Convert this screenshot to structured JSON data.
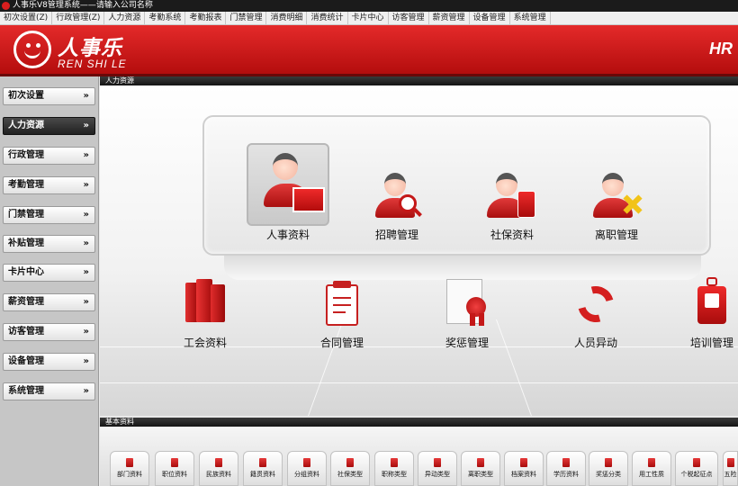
{
  "title": "人事乐V8管理系统——请输入公司名称",
  "menu": [
    "初次设置(Z)",
    "行政管理(Z)",
    "人力资源",
    "考勤系统",
    "考勤报表",
    "门禁管理",
    "消费明细",
    "消费统计",
    "卡片中心",
    "访客管理",
    "薪资管理",
    "设备管理",
    "系统管理"
  ],
  "header": {
    "logo_cn": "人事乐",
    "logo_en": "REN SHI LE",
    "right_text": "HR"
  },
  "sidebar": {
    "items": [
      "初次设置",
      "人力资源",
      "行政管理",
      "考勤管理",
      "门禁管理",
      "补贴管理",
      "卡片中心",
      "薪资管理",
      "访客管理",
      "设备管理",
      "系统管理"
    ],
    "active_index": 1
  },
  "main": {
    "section_title": "人力资源",
    "top_tiles": [
      "人事资料",
      "招聘管理",
      "社保资料",
      "离职管理"
    ],
    "bottom_tiles": [
      "工会资料",
      "合同管理",
      "奖惩管理",
      "人员异动",
      "培训管理"
    ]
  },
  "basic": {
    "section_title": "基本资料",
    "items": [
      "部门资料",
      "职位资料",
      "民族资料",
      "籍贯资料",
      "分组资料",
      "社保类型",
      "职称类型",
      "异动类型",
      "离职类型",
      "档案资料",
      "学历资料",
      "奖惩分类",
      "用工性质",
      "个税起征点",
      "五险"
    ]
  },
  "colors": {
    "brand_red": "#d42020",
    "dark_bar": "#1b1b1b"
  }
}
